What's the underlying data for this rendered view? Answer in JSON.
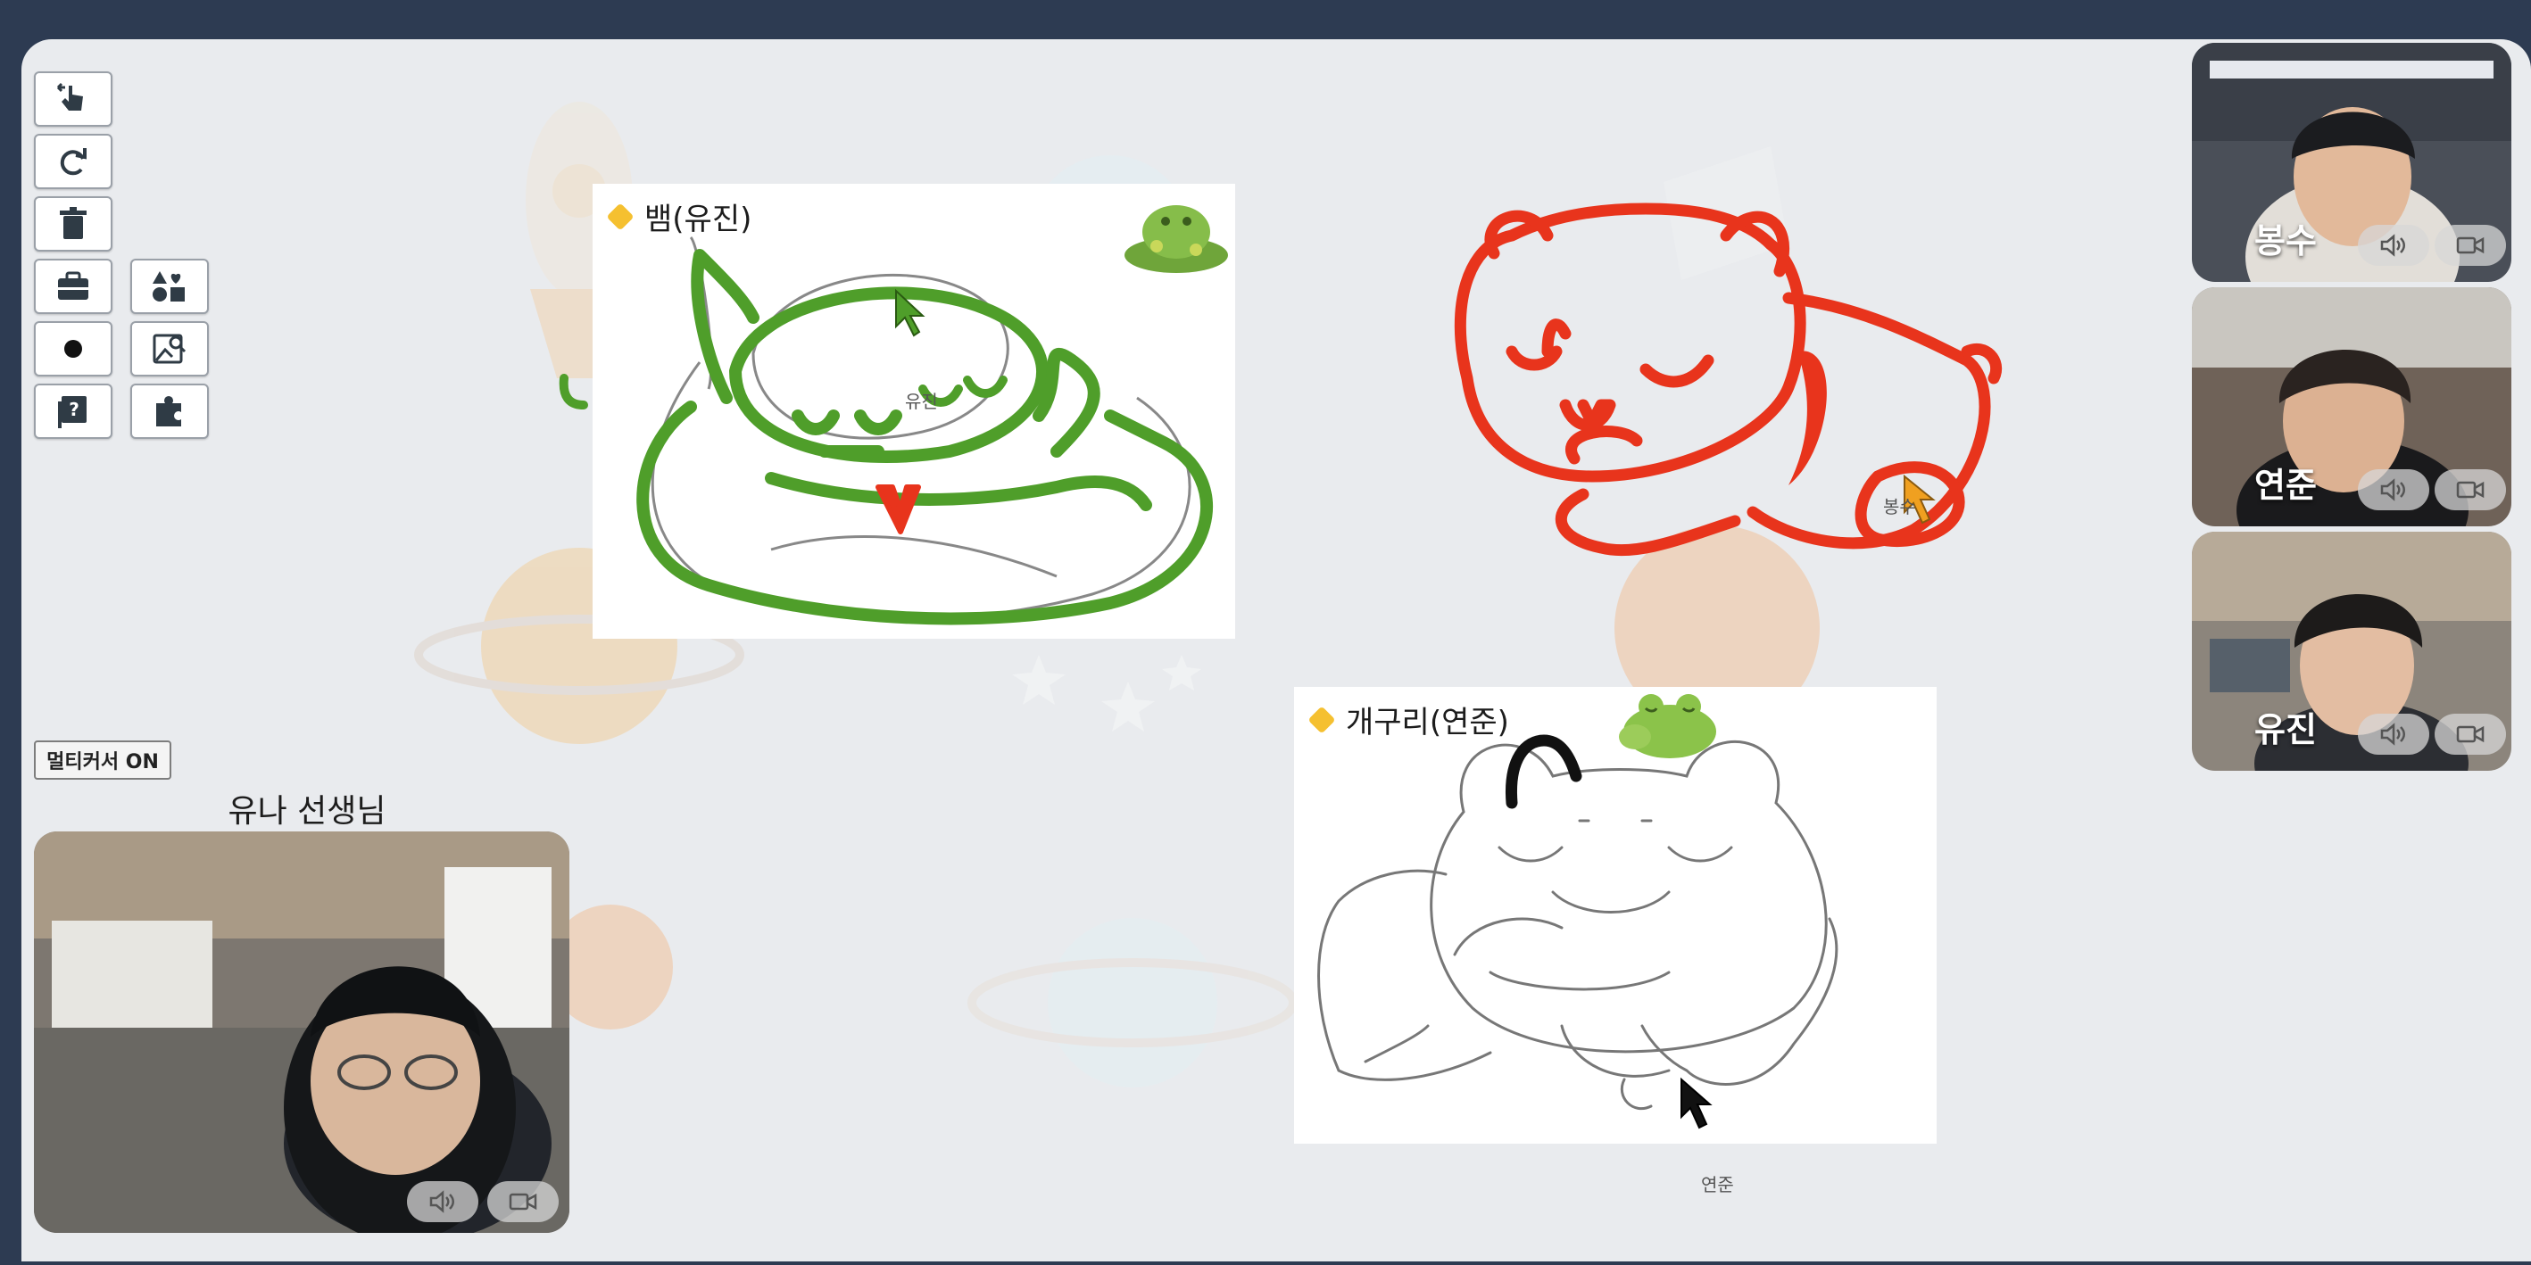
{
  "toolbar": {
    "tools": [
      {
        "name": "pointer-icon"
      },
      {
        "name": "redo-icon"
      },
      {
        "name": "trash-icon"
      },
      {
        "name": "briefcase-icon"
      },
      {
        "name": "shapes-icon"
      },
      {
        "name": "brush-dot-icon"
      },
      {
        "name": "image-search-icon"
      },
      {
        "name": "help-book-icon"
      },
      {
        "name": "puzzle-icon"
      }
    ]
  },
  "cards": {
    "snake": {
      "title": "뱀(유진)",
      "cursor_label": "유진"
    },
    "frog": {
      "title": "개구리(연준)",
      "cursor_label": "연준"
    }
  },
  "free_drawing": {
    "cursor_label": "봉수"
  },
  "multicursor": {
    "label": "멀티커서 ON"
  },
  "teacher": {
    "label": "유나 선생님"
  },
  "participants": [
    {
      "name": "봉수"
    },
    {
      "name": "연준"
    },
    {
      "name": "유진"
    }
  ],
  "colors": {
    "green": "#4f9e2a",
    "red": "#e8341c",
    "accent": "#f5c030",
    "header": "#2d3b52"
  }
}
